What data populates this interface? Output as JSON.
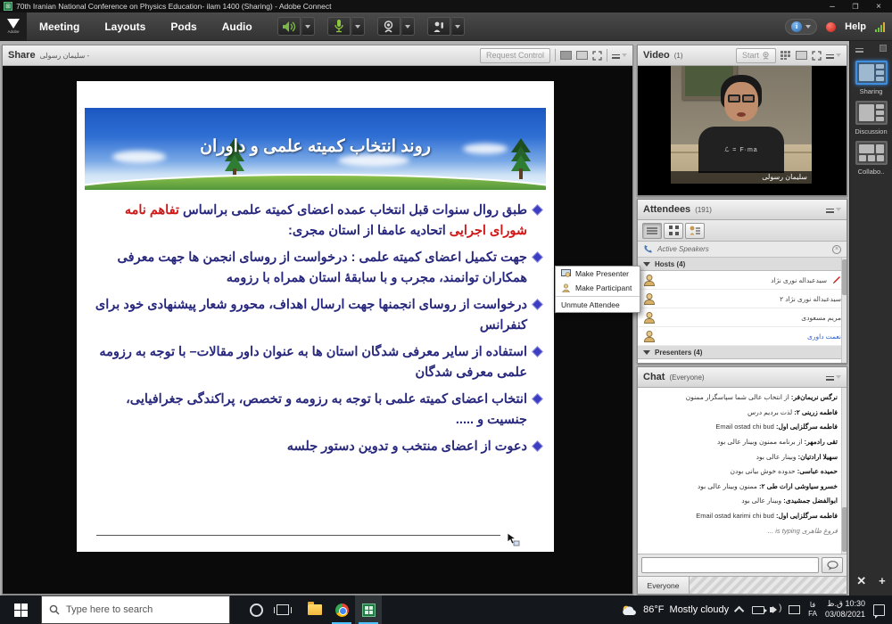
{
  "window": {
    "title": "70th Iranian National Conference on Physics Education- ilam 1400 (Sharing) - Adobe Connect",
    "minimize": "–",
    "maximize": "❐",
    "close": "×"
  },
  "menubar": {
    "items": {
      "meeting": "Meeting",
      "layouts": "Layouts",
      "pods": "Pods",
      "audio": "Audio"
    },
    "help_label": "Help"
  },
  "share_pod": {
    "title": "Share",
    "presenter_name": "سلیمان رسولی -",
    "request_control_label": "Request Control"
  },
  "slide": {
    "title": "روند انتخاب کمیته علمی و داوران",
    "b1a": "طبق روال سنوات قبل انتخاب عمده اعضای کمیته علمی براساس ",
    "b1red": "تفاهم نامه شورای اجرایی",
    "b1b": " اتحادیه عامفا از استان مجری:",
    "b2": "جهت تکمیل اعضای کمیته علمی : درخواست از روسای انجمن ها جهت معرفی همکاران توانمند، مجرب و با سابقهٔ استان همراه با رزومه",
    "b3": "درخواست از روسای انجمنها جهت ارسال اهداف، محورو شعار پیشنهادی خود برای کنفرانس",
    "b4": "استفاده از سایر معرفی شدگان استان ها به عنوان داور مقالات– با توجه به رزومه علمی معرفی شدگان",
    "b5": "انتخاب اعضای کمیته علمی با توجه به رزومه و تخصص، پراکندگی جغرافیایی، جنسیت و .....",
    "b6": "دعوت از اعضای منتخب و تدوین دستور جلسه"
  },
  "context_menu": {
    "make_presenter": "Make Presenter",
    "make_participant": "Make Participant",
    "unmute_attendee": "Unmute Attendee"
  },
  "video_pod": {
    "title": "Video",
    "count": "(1)",
    "start_label": "Start",
    "name_label": "سلیمان رسولی",
    "shirt_text": "ℒ = F·ma"
  },
  "attendees_pod": {
    "title": "Attendees",
    "count": "(191)",
    "active_speakers": "Active Speakers",
    "hosts_header": "Hosts (4)",
    "presenters_header": "Presenters (4)",
    "hosts": [
      {
        "name": "سیدعبداله نوری نژاد"
      },
      {
        "name": "سیدعبداله نوری نژاد ۲"
      },
      {
        "name": "مریم مسعودی"
      },
      {
        "name": "نعمت داوری"
      }
    ]
  },
  "chat_pod": {
    "title": "Chat",
    "scope": "(Everyone)",
    "messages": [
      {
        "name": "نرگس نریمان‌فر",
        "text": "از انتخاب عالی شما سپاسگزار ممنون"
      },
      {
        "name": "فاطمه زرینی ۲",
        "text": "لذت بردیم درس"
      },
      {
        "name": "فاطمه سرگلزایی اول",
        "text": "Email ostad chi bud"
      },
      {
        "name": "تقی رادمهر",
        "text": "از برنامه ممنون وبینار عالی بود"
      },
      {
        "name": "سهیلا ارادتیان",
        "text": "وبینار عالی بود"
      },
      {
        "name": "حمیده عباسی",
        "text": "حدوده خوش بیانی بودن"
      },
      {
        "name": "خسرو سیاوشی ارات طی ۲",
        "text": "ممنون وبینار عالی بود"
      },
      {
        "name": "ابوالفضل جمشیدی",
        "text": "وبینار عالی بود"
      },
      {
        "name": "فاطمه سرگلزایی اول",
        "text": "Email ostad karimi chi bud"
      }
    ],
    "typing": "فروغ طاهری is typing ...",
    "everyone_tab": "Everyone"
  },
  "layout_bar": {
    "sharing": "Sharing",
    "discussion": "Discussion",
    "collaboration": "Collabo.."
  },
  "taskbar": {
    "search_placeholder": "Type here to search",
    "weather_temp": "86°F",
    "weather_desc": "Mostly cloudy",
    "lang_top": "فا",
    "lang_bottom": "FA",
    "time": "10:30 ق.ظ",
    "date": "03/08/2021"
  }
}
